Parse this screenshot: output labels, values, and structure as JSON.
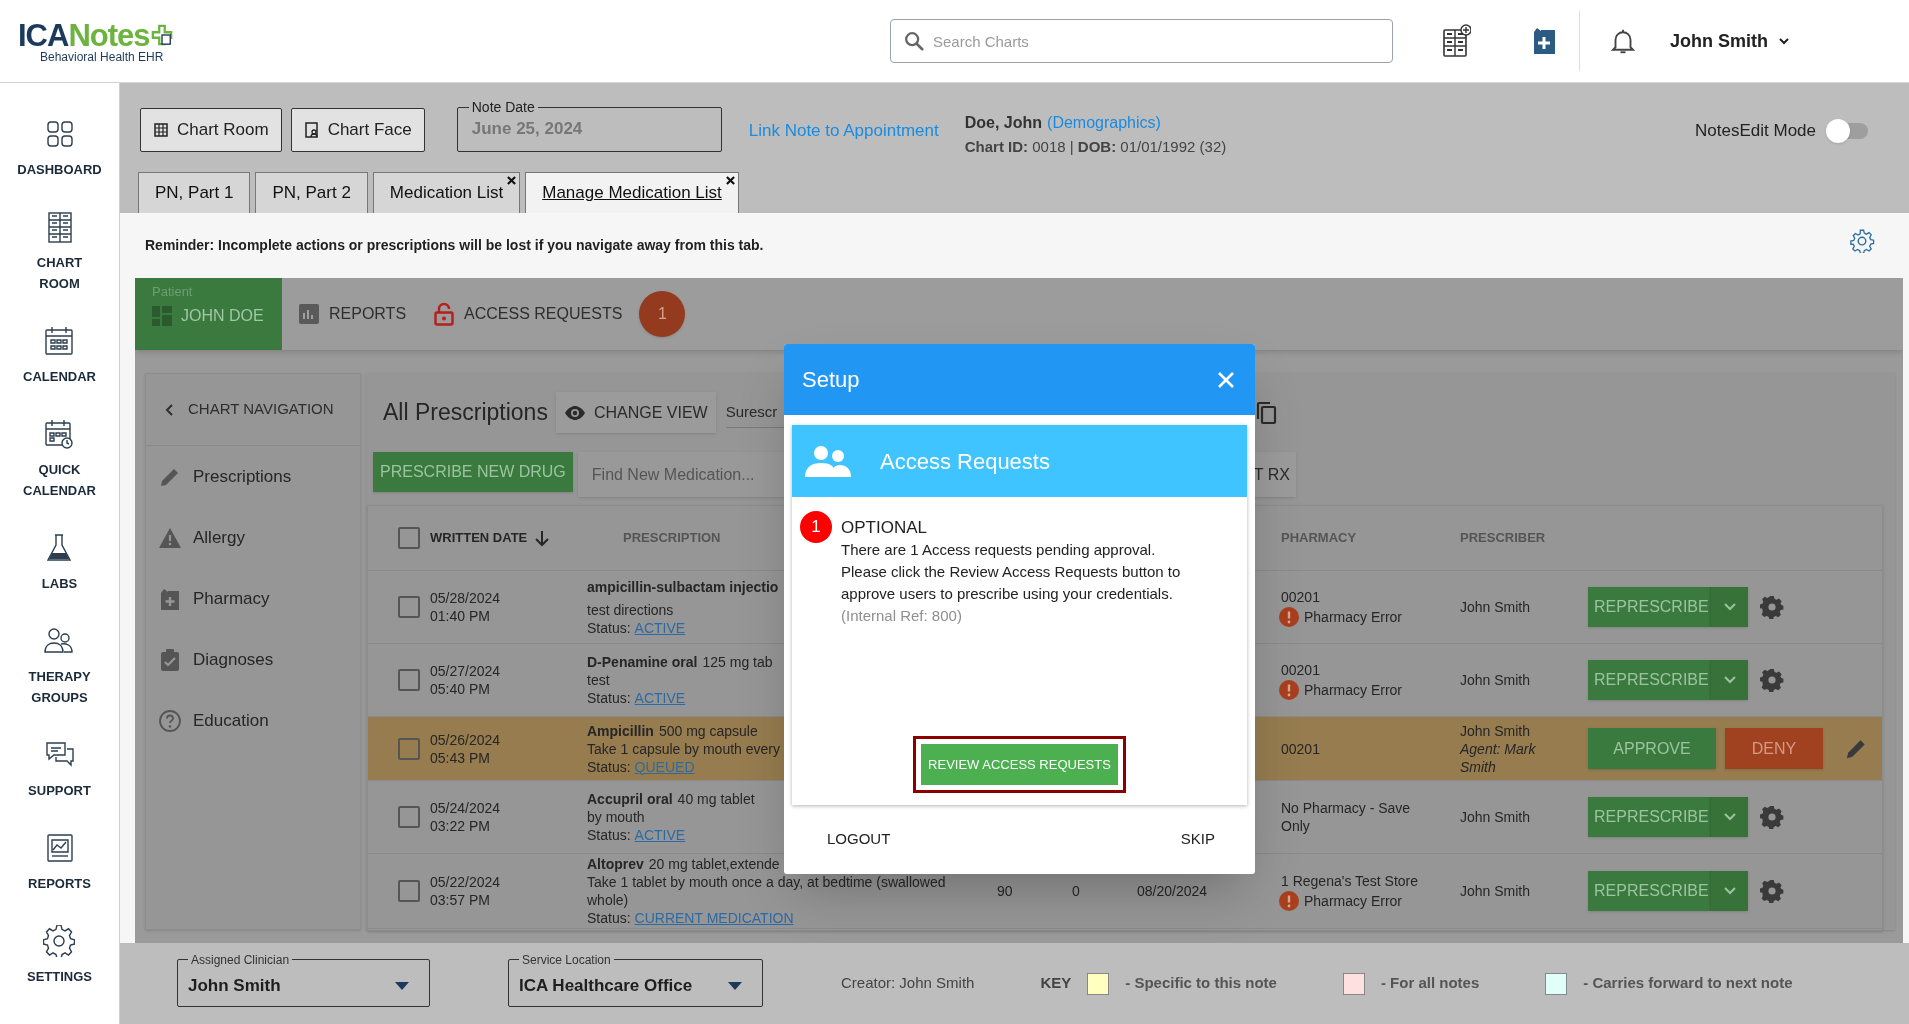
{
  "header": {
    "logo": {
      "parts": [
        "ICA",
        "Notes"
      ],
      "subtitle": "Behavioral Health EHR"
    },
    "search": {
      "placeholder": "Search Charts"
    },
    "user": "John Smith"
  },
  "sidebar": {
    "items": [
      {
        "label": "DASHBOARD"
      },
      {
        "label": "CHART ROOM"
      },
      {
        "label": "CALENDAR"
      },
      {
        "label": "QUICK CALENDAR"
      },
      {
        "label": "LABS"
      },
      {
        "label": "THERAPY GROUPS"
      },
      {
        "label": "SUPPORT"
      },
      {
        "label": "REPORTS"
      },
      {
        "label": "SETTINGS"
      }
    ]
  },
  "toolbar": {
    "buttons": [
      "Chart Room",
      "Chart Face"
    ],
    "note_date": {
      "label": "Note Date",
      "value": "June 25, 2024"
    },
    "link": "Link Note to Appointment",
    "patient": {
      "name": "Doe, John",
      "demographics": "(Demographics)",
      "details": "**Chart ID:** 0018 | **DOB:** 01/01/1992 (32)"
    },
    "edit_mode": {
      "label": "NotesEdit Mode",
      "on": false
    }
  },
  "tabs": [
    {
      "label": "PN, Part 1",
      "selected": false,
      "closable": false
    },
    {
      "label": "PN, Part 2",
      "selected": false,
      "closable": false
    },
    {
      "label": "Medication List",
      "selected": false,
      "closable": true
    },
    {
      "label": "Manage Medication List",
      "selected": true,
      "closable": true
    }
  ],
  "reminder": "Reminder: Incomplete actions or prescriptions will be lost if you navigate away from this tab.",
  "rx_app": {
    "patient_label": "Patient",
    "patient_name": "JOHN DOE",
    "nav": [
      {
        "label": "REPORTS"
      },
      {
        "label": "ACCESS REQUESTS",
        "badge": "1"
      }
    ],
    "chart_nav": {
      "title": "CHART NAVIGATION",
      "items": [
        "Prescriptions",
        "Allergy",
        "Pharmacy",
        "Diagnoses",
        "Education"
      ]
    },
    "title": "All Prescriptions",
    "change_view": "CHANGE VIEW",
    "surescripts": "Surescr",
    "prescribe_button": "PRESCRIBE NEW DRUG",
    "find": {
      "placeholder": "Find New Medication..."
    },
    "rx_button": "T RX",
    "table": {
      "select_all": {
        "checked": false
      },
      "columns": [
        {
          "label": "WRITTEN DATE",
          "sorted": true
        },
        {
          "label": "PRESCRIPTION",
          "sorted": false
        },
        {
          "label": "PHARMACY",
          "sorted": false
        },
        {
          "label": "PRESCRIBER",
          "sorted": false
        }
      ],
      "rows": [
        {
          "checked": false,
          "highlighted": false,
          "kind": "represcribe",
          "date": "05/28/2024",
          "time": "01:40 PM",
          "drug": "ampicillin-sulbactam injectio",
          "directions": "test directions",
          "status_label": "Status:",
          "status": "ACTIVE",
          "pharmacy": "00201",
          "pharmacy_error": "Pharmacy Error",
          "prescriber": "John Smith",
          "actions": [
            "REPRESCRIBE"
          ]
        },
        {
          "checked": false,
          "highlighted": false,
          "kind": "represcribe",
          "date": "05/27/2024",
          "time": "05:40 PM",
          "drug": "D-Penamine oral",
          "strength": "125 mg tab",
          "directions": "test",
          "status_label": "Status:",
          "status": "ACTIVE",
          "pharmacy": "00201",
          "pharmacy_error": "Pharmacy Error",
          "prescriber": "John Smith",
          "actions": [
            "REPRESCRIBE"
          ]
        },
        {
          "checked": false,
          "highlighted": true,
          "kind": "pending",
          "date": "05/26/2024",
          "time": "05:43 PM",
          "drug": "Ampicillin",
          "strength": "500 mg capsule",
          "directions": "Take 1 capsule by mouth every",
          "status_label": "Status:",
          "status": "QUEUED",
          "pharmacy": "00201",
          "prescriber": "John Smith",
          "agent": "Agent: Mark Smith",
          "actions": [
            "APPROVE",
            "DENY"
          ]
        },
        {
          "checked": false,
          "highlighted": false,
          "kind": "represcribe",
          "date": "05/24/2024",
          "time": "03:22 PM",
          "drug": "Accupril oral",
          "strength": "40 mg tablet",
          "directions": "by mouth",
          "status_label": "Status:",
          "status": "ACTIVE",
          "pharmacy": "No Pharmacy - Save Only",
          "prescriber": "John Smith",
          "actions": [
            "REPRESCRIBE"
          ]
        },
        {
          "checked": false,
          "highlighted": false,
          "kind": "represcribe",
          "date": "05/22/2024",
          "time": "03:57 PM",
          "drug": "Altoprev",
          "strength": "20 mg tablet,extende",
          "directions": "Take 1 tablet by mouth once a day, at bedtime (swallowed whole)",
          "status_label": "Status:",
          "status": "CURRENT MEDICATION",
          "quantity": "90",
          "refills": "0",
          "fill_date": "08/20/2024",
          "pharmacy": "1 Regena's Test Store",
          "pharmacy_error": "Pharmacy Error",
          "prescriber": "John Smith",
          "actions": [
            "REPRESCRIBE"
          ]
        }
      ]
    }
  },
  "dialog": {
    "title": "Setup",
    "card_title": "Access Requests",
    "badge": "1",
    "heading": "OPTIONAL",
    "message": "There are 1 Access requests pending approval. Please click the Review Access Requests button to approve users to prescribe using your credentials.",
    "ref": "(Internal Ref: 800)",
    "primary": "REVIEW ACCESS REQUESTS",
    "footer": [
      "LOGOUT",
      "SKIP"
    ]
  },
  "footer": {
    "clinician": {
      "label": "Assigned Clinician",
      "value": "John Smith"
    },
    "location": {
      "label": "Service Location",
      "value": "ICA Healthcare Office"
    },
    "creator": "Creator: John Smith",
    "key_label": "KEY",
    "key": [
      {
        "color": "#ffffc0",
        "label": "- Specific to this note"
      },
      {
        "color": "#ffe0e0",
        "label": "- For all notes"
      },
      {
        "color": "#e0fff8",
        "label": "- Carries forward to next note"
      }
    ]
  }
}
